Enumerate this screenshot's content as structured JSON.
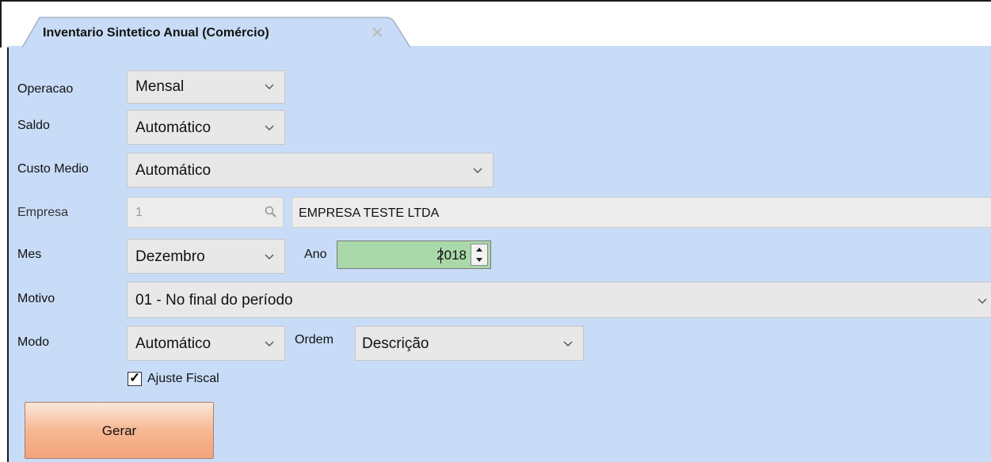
{
  "tab": {
    "title": "Inventario Sintetico Anual (Comércio)",
    "close_glyph": "✕"
  },
  "form": {
    "operacao": {
      "label": "Operacao",
      "value": "Mensal"
    },
    "saldo": {
      "label": "Saldo",
      "value": "Automático"
    },
    "custo_medio": {
      "label": "Custo Medio",
      "value": "Automático"
    },
    "empresa": {
      "label": "Empresa",
      "code": "1",
      "name": "EMPRESA TESTE LTDA"
    },
    "mes": {
      "label": "Mes",
      "value": "Dezembro"
    },
    "ano": {
      "label": "Ano",
      "value": "2018"
    },
    "motivo": {
      "label": "Motivo",
      "value": "01 - No final do período"
    },
    "modo": {
      "label": "Modo",
      "value": "Automático"
    },
    "ordem": {
      "label": "Ordem",
      "value": "Descrição"
    },
    "ajuste_fiscal": {
      "label": "Ajuste Fiscal",
      "checked": true,
      "check_glyph": "✓"
    }
  },
  "actions": {
    "gerar_label": "Gerar"
  },
  "colors": {
    "panel_bg": "#c8dcf7",
    "combo_bg": "#e8e8e8",
    "ano_bg": "#a9d8a9",
    "button_accent": "#f6b793"
  },
  "icons": {
    "search": "search-icon",
    "chevron": "chevron-down-icon",
    "spin": "spin-arrows-icon"
  }
}
